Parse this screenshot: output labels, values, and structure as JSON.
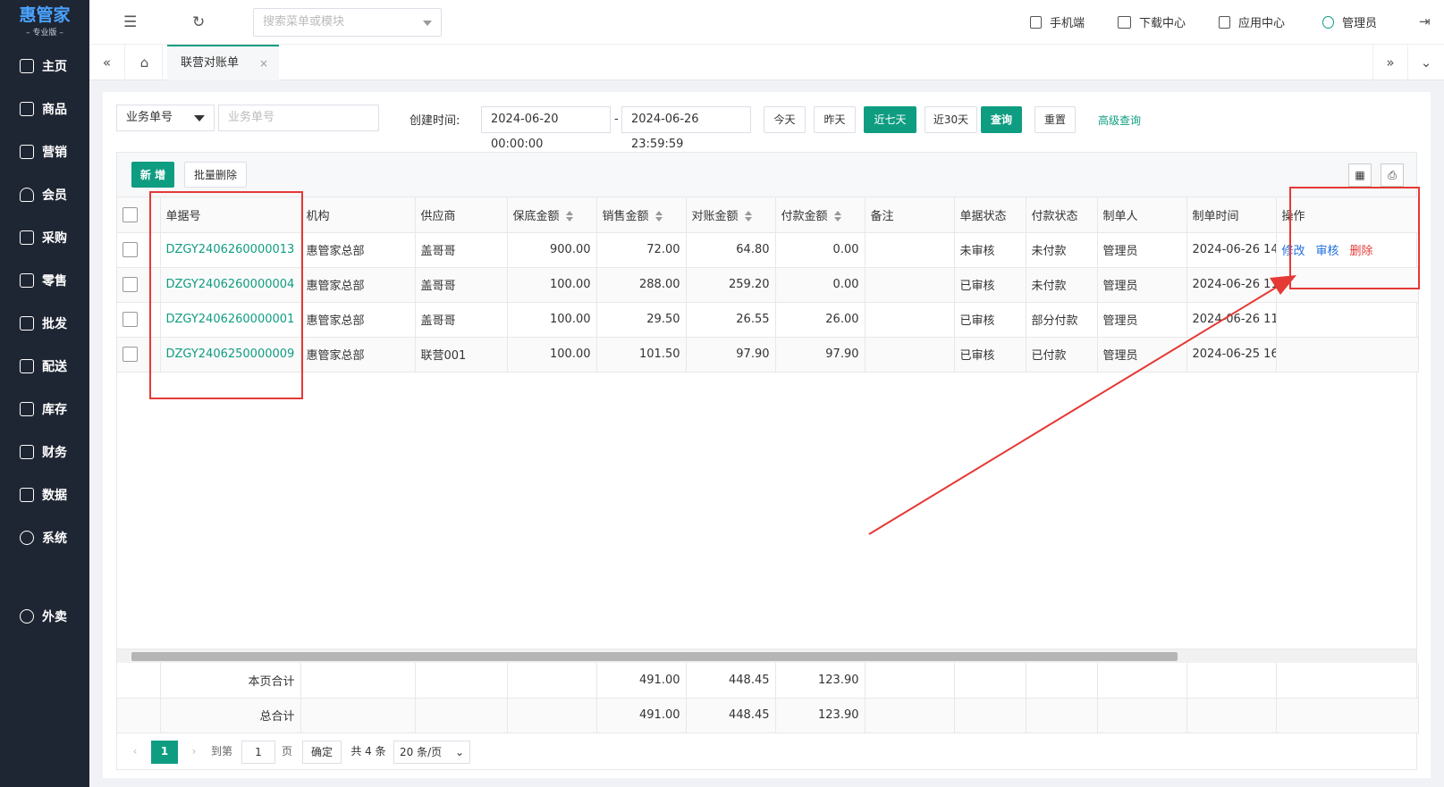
{
  "app": {
    "logo": "惠管家",
    "logo_sub": "– 专业版 –"
  },
  "sidebar": {
    "items": [
      {
        "label": "主页"
      },
      {
        "label": "商品"
      },
      {
        "label": "营销"
      },
      {
        "label": "会员"
      },
      {
        "label": "采购"
      },
      {
        "label": "零售"
      },
      {
        "label": "批发"
      },
      {
        "label": "配送"
      },
      {
        "label": "库存"
      },
      {
        "label": "财务"
      },
      {
        "label": "数据"
      },
      {
        "label": "系统"
      },
      {
        "label": "外卖"
      }
    ]
  },
  "topbar": {
    "search_placeholder": "搜索菜单或模块",
    "mobile": "手机端",
    "download": "下载中心",
    "apps": "应用中心",
    "user": "管理员"
  },
  "tabs": {
    "active": "联营对账单"
  },
  "filter": {
    "type_select": "业务单号",
    "doc_placeholder": "业务单号",
    "created_label": "创建时间:",
    "date_from": "2024-06-20 00:00:00",
    "date_sep": "-",
    "date_to": "2024-06-26 23:59:59",
    "today": "今天",
    "yesterday": "昨天",
    "last7": "近七天",
    "last30": "近30天",
    "query": "查询",
    "reset": "重置",
    "advanced": "高级查询"
  },
  "toolbar": {
    "add": "新 增",
    "batch_delete": "批量删除"
  },
  "table": {
    "headers": {
      "doc_no": "单据号",
      "org": "机构",
      "supplier": "供应商",
      "guarantee": "保底金额",
      "sales": "销售金额",
      "recon": "对账金额",
      "paid": "付款金额",
      "remark": "备注",
      "doc_status": "单据状态",
      "pay_status": "付款状态",
      "creator": "制单人",
      "created_at": "制单时间",
      "actions": "操作"
    },
    "rows": [
      {
        "doc_no": "DZGY2406260000013",
        "org": "惠管家总部",
        "supplier": "盖哥哥",
        "guarantee": "900.00",
        "sales": "72.00",
        "recon": "64.80",
        "paid": "0.00",
        "remark": "",
        "doc_status": "未审核",
        "pay_status": "未付款",
        "creator": "管理员",
        "created_at": "2024-06-26 14:",
        "actions": {
          "edit": "修改",
          "audit": "审核",
          "delete": "删除"
        }
      },
      {
        "doc_no": "DZGY2406260000004",
        "org": "惠管家总部",
        "supplier": "盖哥哥",
        "guarantee": "100.00",
        "sales": "288.00",
        "recon": "259.20",
        "paid": "0.00",
        "remark": "",
        "doc_status": "已审核",
        "pay_status": "未付款",
        "creator": "管理员",
        "created_at": "2024-06-26 11:"
      },
      {
        "doc_no": "DZGY2406260000001",
        "org": "惠管家总部",
        "supplier": "盖哥哥",
        "guarantee": "100.00",
        "sales": "29.50",
        "recon": "26.55",
        "paid": "26.00",
        "remark": "",
        "doc_status": "已审核",
        "pay_status": "部分付款",
        "creator": "管理员",
        "created_at": "2024-06-26 11:"
      },
      {
        "doc_no": "DZGY2406250000009",
        "org": "惠管家总部",
        "supplier": "联营001",
        "guarantee": "100.00",
        "sales": "101.50",
        "recon": "97.90",
        "paid": "97.90",
        "remark": "",
        "doc_status": "已审核",
        "pay_status": "已付款",
        "creator": "管理员",
        "created_at": "2024-06-25 16:"
      }
    ],
    "summary": [
      {
        "label": "本页合计",
        "sales": "491.00",
        "recon": "448.45",
        "paid": "123.90"
      },
      {
        "label": "总合计",
        "sales": "491.00",
        "recon": "448.45",
        "paid": "123.90"
      }
    ]
  },
  "pager": {
    "current": "1",
    "goto_label": "到第",
    "page_input": "1",
    "page_unit": "页",
    "confirm": "确定",
    "total": "共 4 条",
    "page_size": "20 条/页"
  },
  "colors": {
    "brand": "#0f9d82",
    "sidebar": "#1f2633",
    "annotation": "#e53935"
  }
}
